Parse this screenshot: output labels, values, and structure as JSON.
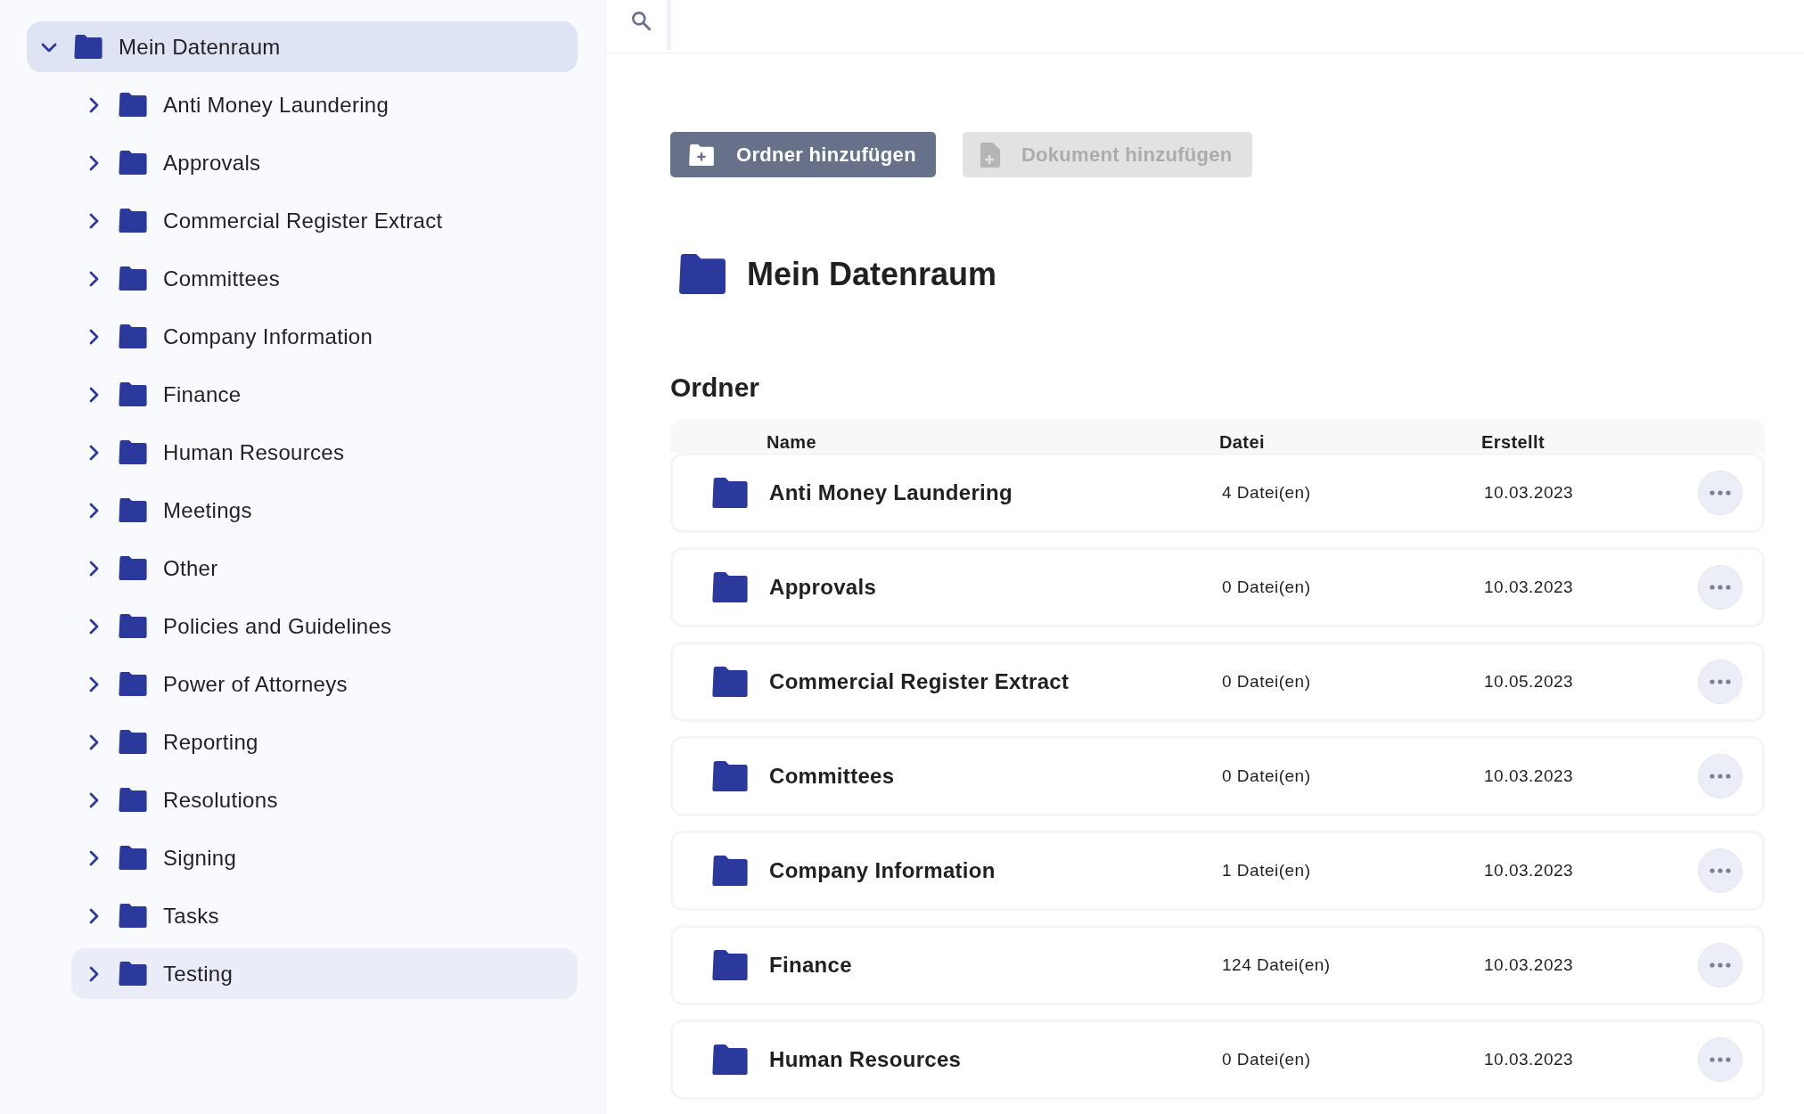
{
  "sidebar": {
    "tree": [
      {
        "label": "Mein Datenraum",
        "expanded": true,
        "selected": true,
        "hovered": false,
        "children": [
          {
            "label": "Anti Money Laundering",
            "expanded": false,
            "selected": false,
            "hovered": false
          },
          {
            "label": "Approvals",
            "expanded": false,
            "selected": false,
            "hovered": false
          },
          {
            "label": "Commercial Register Extract",
            "expanded": false,
            "selected": false,
            "hovered": false
          },
          {
            "label": "Committees",
            "expanded": false,
            "selected": false,
            "hovered": false
          },
          {
            "label": "Company Information",
            "expanded": false,
            "selected": false,
            "hovered": false
          },
          {
            "label": "Finance",
            "expanded": false,
            "selected": false,
            "hovered": false
          },
          {
            "label": "Human Resources",
            "expanded": false,
            "selected": false,
            "hovered": false
          },
          {
            "label": "Meetings",
            "expanded": false,
            "selected": false,
            "hovered": false
          },
          {
            "label": "Other",
            "expanded": false,
            "selected": false,
            "hovered": false
          },
          {
            "label": "Policies and Guidelines",
            "expanded": false,
            "selected": false,
            "hovered": false
          },
          {
            "label": "Power of Attorneys",
            "expanded": false,
            "selected": false,
            "hovered": false
          },
          {
            "label": "Reporting",
            "expanded": false,
            "selected": false,
            "hovered": false
          },
          {
            "label": "Resolutions",
            "expanded": false,
            "selected": false,
            "hovered": false
          },
          {
            "label": "Signing",
            "expanded": false,
            "selected": false,
            "hovered": false
          },
          {
            "label": "Tasks",
            "expanded": false,
            "selected": false,
            "hovered": false
          },
          {
            "label": "Testing",
            "expanded": false,
            "selected": false,
            "hovered": true
          }
        ]
      }
    ]
  },
  "toolbar": {
    "buttons": [
      {
        "label": "Ordner hinzufügen",
        "kind": "folder",
        "disabled": false
      },
      {
        "label": "Dokument hinzufügen",
        "kind": "document",
        "disabled": true
      }
    ]
  },
  "title": "Mein Datenraum",
  "section_title": "Ordner",
  "table": {
    "columns": [
      "Name",
      "Datei",
      "Erstellt"
    ],
    "rows": [
      {
        "name": "Anti Money Laundering",
        "files": "4 Datei(en)",
        "created": "10.03.2023"
      },
      {
        "name": "Approvals",
        "files": "0 Datei(en)",
        "created": "10.03.2023"
      },
      {
        "name": "Commercial Register Extract",
        "files": "0 Datei(en)",
        "created": "10.05.2023"
      },
      {
        "name": "Committees",
        "files": "0 Datei(en)",
        "created": "10.03.2023"
      },
      {
        "name": "Company Information",
        "files": "1 Datei(en)",
        "created": "10.03.2023"
      },
      {
        "name": "Finance",
        "files": "124 Datei(en)",
        "created": "10.03.2023"
      },
      {
        "name": "Human Resources",
        "files": "0 Datei(en)",
        "created": "10.03.2023"
      }
    ]
  }
}
